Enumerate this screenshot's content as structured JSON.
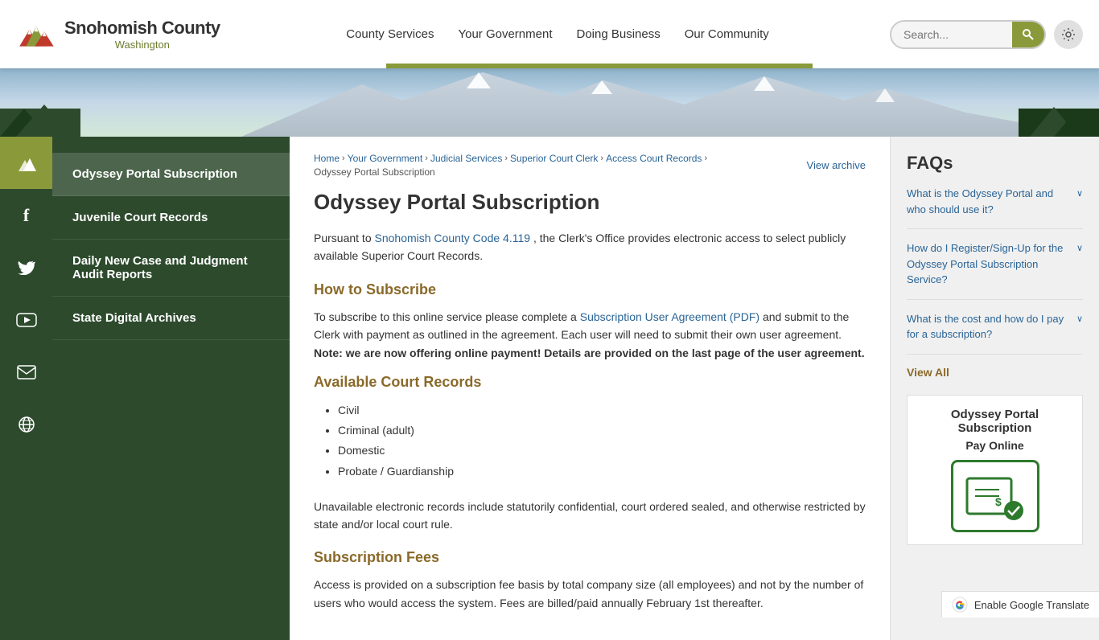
{
  "header": {
    "logo_name": "Snohomish County",
    "logo_sub": "Washington",
    "nav_items": [
      "County Services",
      "Your Government",
      "Doing Business",
      "Our Community"
    ],
    "search_placeholder": "Search...",
    "search_label": "Search ."
  },
  "sidebar": {
    "items": [
      {
        "id": "odyssey",
        "label": "Odyssey Portal Subscription",
        "active": true
      },
      {
        "id": "juvenile",
        "label": "Juvenile Court Records",
        "active": false
      },
      {
        "id": "daily",
        "label": "Daily New Case and Judgment Audit Reports",
        "active": false
      },
      {
        "id": "state",
        "label": "State Digital Archives",
        "active": false
      }
    ]
  },
  "icon_sidebar": {
    "items": [
      {
        "id": "people",
        "icon": "⛰",
        "label": "people-icon",
        "active": true
      },
      {
        "id": "facebook",
        "icon": "f",
        "label": "facebook-icon",
        "active": false
      },
      {
        "id": "twitter",
        "icon": "𝕏",
        "label": "twitter-icon",
        "active": false
      },
      {
        "id": "youtube",
        "icon": "▶",
        "label": "youtube-icon",
        "active": false
      },
      {
        "id": "email",
        "icon": "✉",
        "label": "email-icon",
        "active": false
      },
      {
        "id": "globe",
        "icon": "🌐",
        "label": "globe-icon",
        "active": false
      }
    ]
  },
  "breadcrumb": {
    "links": [
      "Home",
      "Your Government",
      "Judicial Services",
      "Superior Court Clerk",
      "Access Court Records"
    ],
    "current": "Odyssey Portal Subscription",
    "view_archive": "View archive"
  },
  "content": {
    "title": "Odyssey Portal Subscription",
    "intro": "Pursuant to",
    "intro_link_text": "Snohomish County Code 4.119",
    "intro_rest": ", the Clerk's Office provides electronic access to select publicly available Superior Court Records.",
    "how_to_subscribe_heading": "How to Subscribe",
    "subscribe_text_1": "To subscribe to this online service please complete a",
    "subscribe_link": "Subscription User Agreement (PDF)",
    "subscribe_text_2": "and submit to the Clerk with payment as outlined in the agreement. Each user will need to submit their own user agreement.",
    "subscribe_bold": "Note: we are now offering online payment! Details are provided on the last page of the user agreement.",
    "available_records_heading": "Available Court Records",
    "court_records_list": [
      "Civil",
      "Criminal (adult)",
      "Domestic",
      "Probate / Guardianship"
    ],
    "unavailable_text": "Unavailable electronic records include statutorily confidential, court ordered sealed, and otherwise restricted by state and/or local court rule.",
    "subscription_fees_heading": "Subscription Fees",
    "fees_text": "Access is provided on a subscription fee basis by total company size (all employees) and not by the number of users who would access the system. Fees are billed/paid annually February 1st thereafter."
  },
  "faqs": {
    "title": "FAQs",
    "items": [
      {
        "question": "What is the Odyssey Portal and who should use it?"
      },
      {
        "question": "How do I Register/Sign-Up for the Odyssey Portal Subscription Service?"
      },
      {
        "question": "What is the cost and how do I pay for a subscription?"
      }
    ],
    "view_all": "View All"
  },
  "pay_online": {
    "title": "Odyssey Portal Subscription",
    "subtitle": "Pay Online"
  },
  "translate": {
    "label": "Enable Google Translate"
  }
}
